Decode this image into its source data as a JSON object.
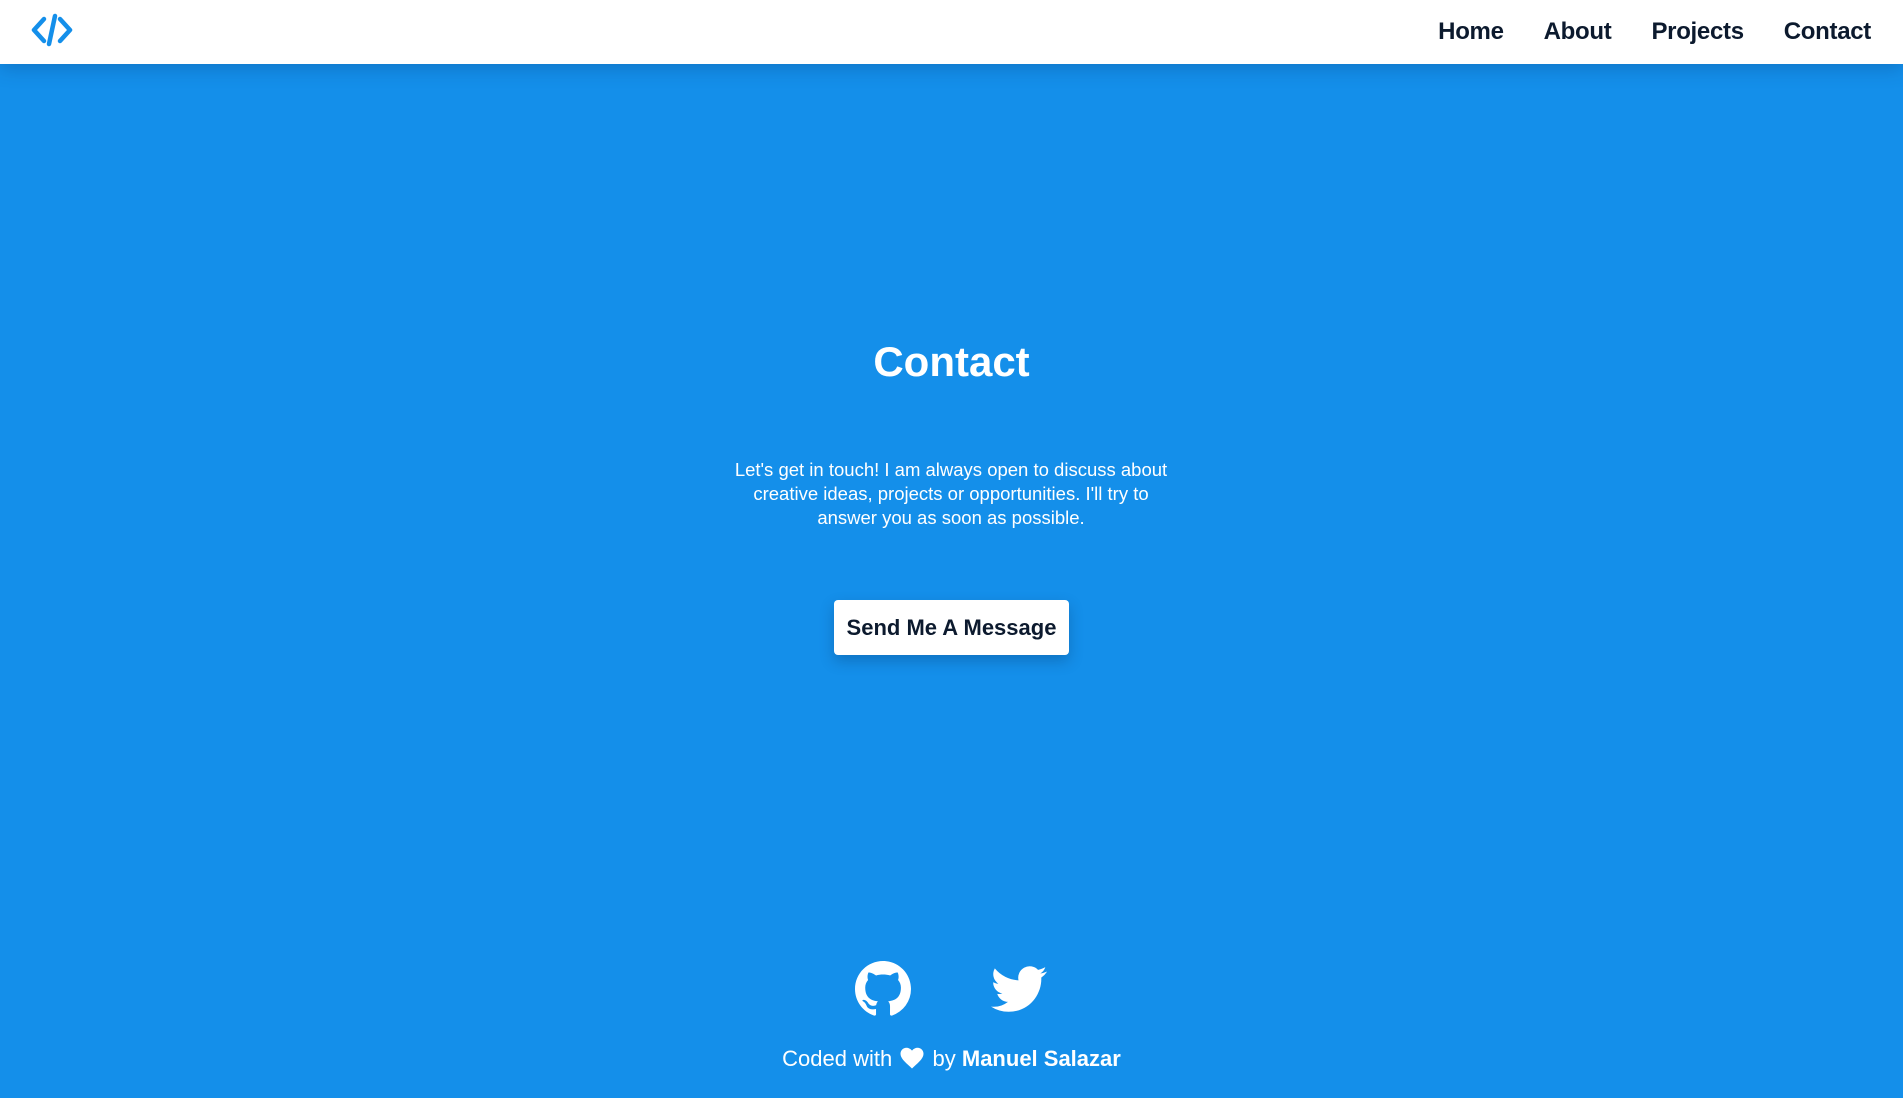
{
  "navbar": {
    "logo_icon": "code-brackets-icon",
    "links": [
      {
        "label": "Home"
      },
      {
        "label": "About"
      },
      {
        "label": "Projects"
      },
      {
        "label": "Contact"
      }
    ]
  },
  "contact": {
    "title": "Contact",
    "intro": "Let's get in touch! I am always open to discuss about creative ideas, projects or opportunities. I'll try to answer you as soon as possible.",
    "button_label": "Send Me A Message"
  },
  "social": {
    "links": [
      {
        "icon": "github-icon"
      },
      {
        "icon": "twitter-icon"
      }
    ]
  },
  "footer": {
    "prefix": "Coded with",
    "heart_icon": "heart-icon",
    "middle": "by",
    "author": "Manuel Salazar"
  },
  "colors": {
    "background": "#148fea",
    "navbar": "#ffffff",
    "nav_text": "#0c1a2e",
    "accent": "#148fea",
    "text_light": "#ffffff"
  }
}
